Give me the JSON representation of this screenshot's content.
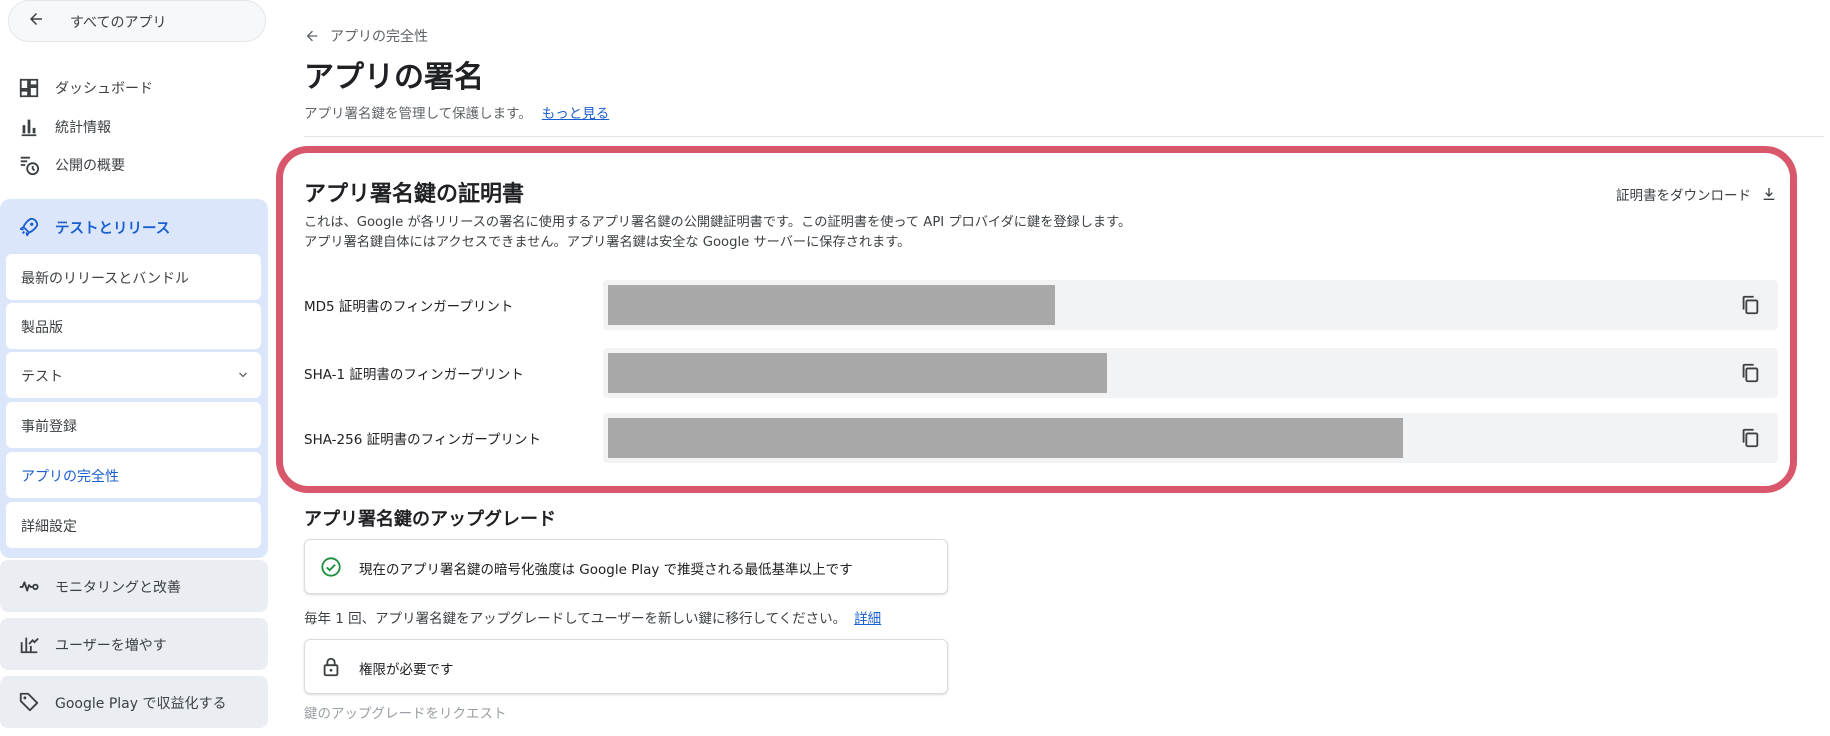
{
  "sidebar": {
    "back_label": "すべてのアプリ",
    "items": [
      {
        "label": "ダッシュボード",
        "icon": "dashboard-icon"
      },
      {
        "label": "統計情報",
        "icon": "bar-chart-icon"
      },
      {
        "label": "公開の概要",
        "icon": "publishing-overview-icon"
      }
    ],
    "group": {
      "label": "テストとリリース",
      "icon": "rocket-icon",
      "items": [
        {
          "label": "最新のリリースとバンドル"
        },
        {
          "label": "製品版"
        },
        {
          "label": "テスト",
          "expandable": true
        },
        {
          "label": "事前登録"
        },
        {
          "label": "アプリの完全性",
          "active": true
        },
        {
          "label": "詳細設定"
        }
      ]
    },
    "tiles": [
      {
        "label": "モニタリングと改善",
        "icon": "vitals-icon"
      },
      {
        "label": "ユーザーを増やす",
        "icon": "growth-icon"
      },
      {
        "label": "Google Play で収益化する",
        "icon": "tag-icon"
      }
    ]
  },
  "main": {
    "breadcrumb": "アプリの完全性",
    "title": "アプリの署名",
    "subtitle": "アプリ署名鍵を管理して保護します。",
    "learn_more": "もっと見る",
    "cert": {
      "title": "アプリ署名鍵の証明書",
      "download": "証明書をダウンロード",
      "desc1": "これは、Google が各リリースの署名に使用するアプリ署名鍵の公開鍵証明書です。この証明書を使って API プロバイダに鍵を登録します。",
      "desc2": "アプリ署名鍵自体にはアクセスできません。アプリ署名鍵は安全な Google サーバーに保存されます。",
      "fingerprints": [
        {
          "label": "MD5 証明書のフィンガープリント",
          "value_redacted": true
        },
        {
          "label": "SHA-1 証明書のフィンガープリント",
          "value_redacted": true
        },
        {
          "label": "SHA-256 証明書のフィンガープリント",
          "value_redacted": true
        }
      ]
    },
    "upgrade": {
      "title": "アプリ署名鍵のアップグレード",
      "status": "現在のアプリ署名鍵の暗号化強度は Google Play で推奨される最低基準以上です",
      "note": "毎年 1 回、アプリ署名鍵をアップグレードしてユーザーを新しい鍵に移行してください。",
      "note_link": "詳細",
      "permission": "権限が必要です",
      "request": "鍵のアップグレードをリクエスト"
    }
  },
  "colors": {
    "accent": "#1a5fd0",
    "highlight": "#d9576a",
    "group_bg": "#dbe6fb",
    "success": "#1e8e3e",
    "redaction": "#a8a8a8"
  }
}
